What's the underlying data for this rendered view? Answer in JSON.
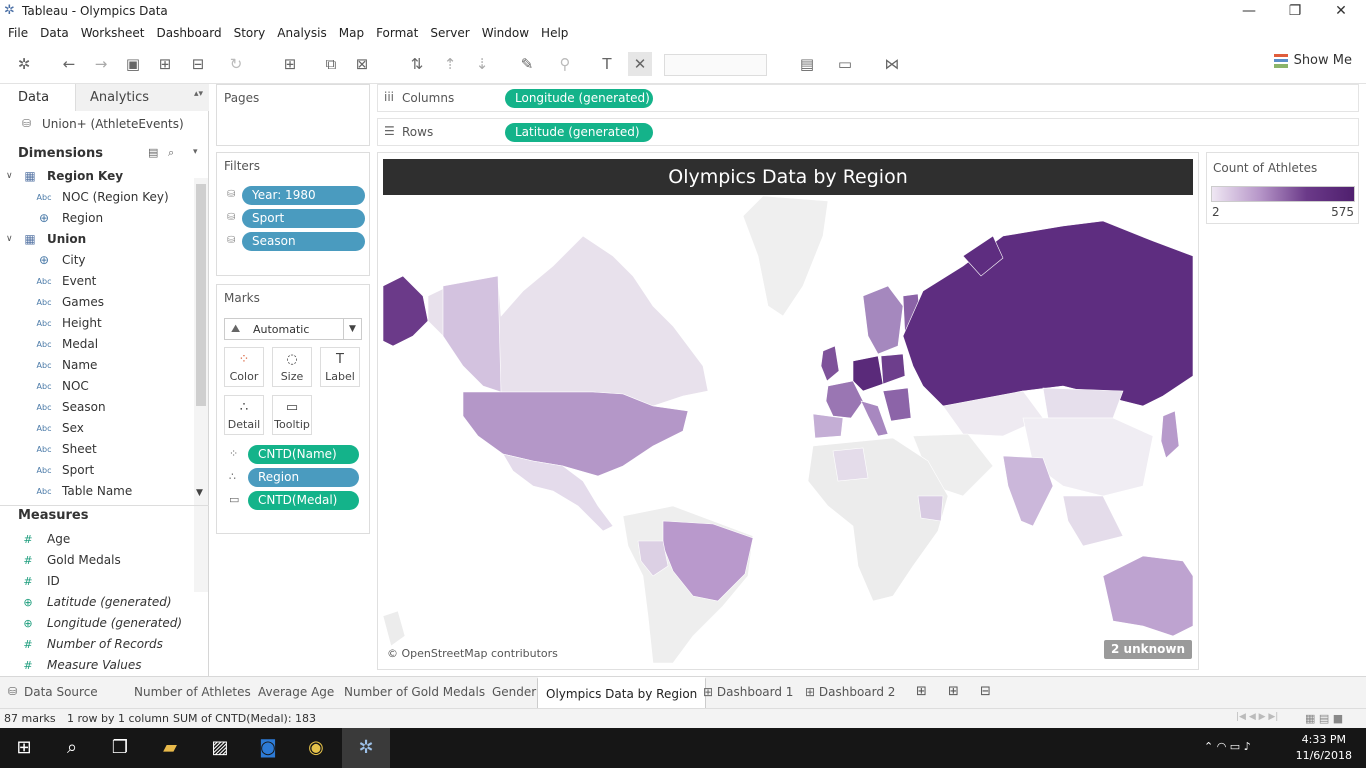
{
  "window": {
    "title": "Tableau - Olympics Data",
    "min": "—",
    "max": "❐",
    "close": "✕"
  },
  "menu": [
    "File",
    "Data",
    "Worksheet",
    "Dashboard",
    "Story",
    "Analysis",
    "Map",
    "Format",
    "Server",
    "Window",
    "Help"
  ],
  "toolbar": {
    "show_me": "Show Me"
  },
  "left": {
    "tab_data": "Data",
    "tab_analytics": "Analytics",
    "datasource": "Union+ (AthleteEvents)",
    "dimensions_title": "Dimensions",
    "measures_title": "Measures",
    "dimensions": [
      {
        "label": "Region Key",
        "icon": "▦",
        "group": true
      },
      {
        "label": "NOC (Region Key)",
        "icon": "Abc"
      },
      {
        "label": "Region",
        "icon": "⊕"
      },
      {
        "label": "Union",
        "icon": "▦",
        "group": true
      },
      {
        "label": "City",
        "icon": "⊕"
      },
      {
        "label": "Event",
        "icon": "Abc"
      },
      {
        "label": "Games",
        "icon": "Abc"
      },
      {
        "label": "Height",
        "icon": "Abc"
      },
      {
        "label": "Medal",
        "icon": "Abc"
      },
      {
        "label": "Name",
        "icon": "Abc"
      },
      {
        "label": "NOC",
        "icon": "Abc"
      },
      {
        "label": "Season",
        "icon": "Abc"
      },
      {
        "label": "Sex",
        "icon": "Abc"
      },
      {
        "label": "Sheet",
        "icon": "Abc"
      },
      {
        "label": "Sport",
        "icon": "Abc"
      },
      {
        "label": "Table Name",
        "icon": "Abc"
      }
    ],
    "measures": [
      {
        "label": "Age",
        "icon": "#",
        "italic": false
      },
      {
        "label": "Gold Medals",
        "icon": "#",
        "italic": false
      },
      {
        "label": "ID",
        "icon": "#",
        "italic": false
      },
      {
        "label": "Latitude (generated)",
        "icon": "⊕",
        "italic": true
      },
      {
        "label": "Longitude (generated)",
        "icon": "⊕",
        "italic": true
      },
      {
        "label": "Number of Records",
        "icon": "#",
        "italic": true
      },
      {
        "label": "Measure Values",
        "icon": "#",
        "italic": true
      }
    ]
  },
  "pages": {
    "title": "Pages"
  },
  "filters": {
    "title": "Filters",
    "items": [
      "Year: 1980",
      "Sport",
      "Season"
    ]
  },
  "marks": {
    "title": "Marks",
    "type": "Automatic",
    "buttons": [
      {
        "label": "Color",
        "glyph": "⁘"
      },
      {
        "label": "Size",
        "glyph": "◌"
      },
      {
        "label": "Label",
        "glyph": "T"
      },
      {
        "label": "Detail",
        "glyph": "∴"
      },
      {
        "label": "Tooltip",
        "glyph": "▭"
      }
    ],
    "pills": [
      {
        "label": "CNTD(Name)",
        "color": "green",
        "icon": "⁘"
      },
      {
        "label": "Region",
        "color": "blue",
        "icon": "∴"
      },
      {
        "label": "CNTD(Medal)",
        "color": "green",
        "icon": "▭"
      }
    ]
  },
  "shelves": {
    "columns_label": "Columns",
    "columns_pill": "Longitude (generated)",
    "rows_label": "Rows",
    "rows_pill": "Latitude (generated)"
  },
  "viz": {
    "title": "Olympics Data by Region",
    "attribution": "© OpenStreetMap contributors",
    "unknown": "2 unknown"
  },
  "legend": {
    "title": "Count of Athletes",
    "min": "2",
    "max": "575",
    "colors": [
      "#efe7f3",
      "#4f1f6e"
    ]
  },
  "sheet_tabs": [
    {
      "label": "Data Source",
      "active": false
    },
    {
      "label": "Number of Athletes",
      "active": false
    },
    {
      "label": "Average Age",
      "active": false
    },
    {
      "label": "Number of Gold Medals",
      "active": false
    },
    {
      "label": "Gender",
      "active": false
    },
    {
      "label": "Olympics Data by Region",
      "active": true
    },
    {
      "label": "Dashboard 1",
      "active": false
    },
    {
      "label": "Dashboard 2",
      "active": false
    }
  ],
  "status": {
    "marks": "87 marks",
    "dims": "1 row by 1 column",
    "sum": "SUM of CNTD(Medal): 183"
  },
  "taskbar": {
    "time": "4:33 PM",
    "date": "11/6/2018"
  }
}
